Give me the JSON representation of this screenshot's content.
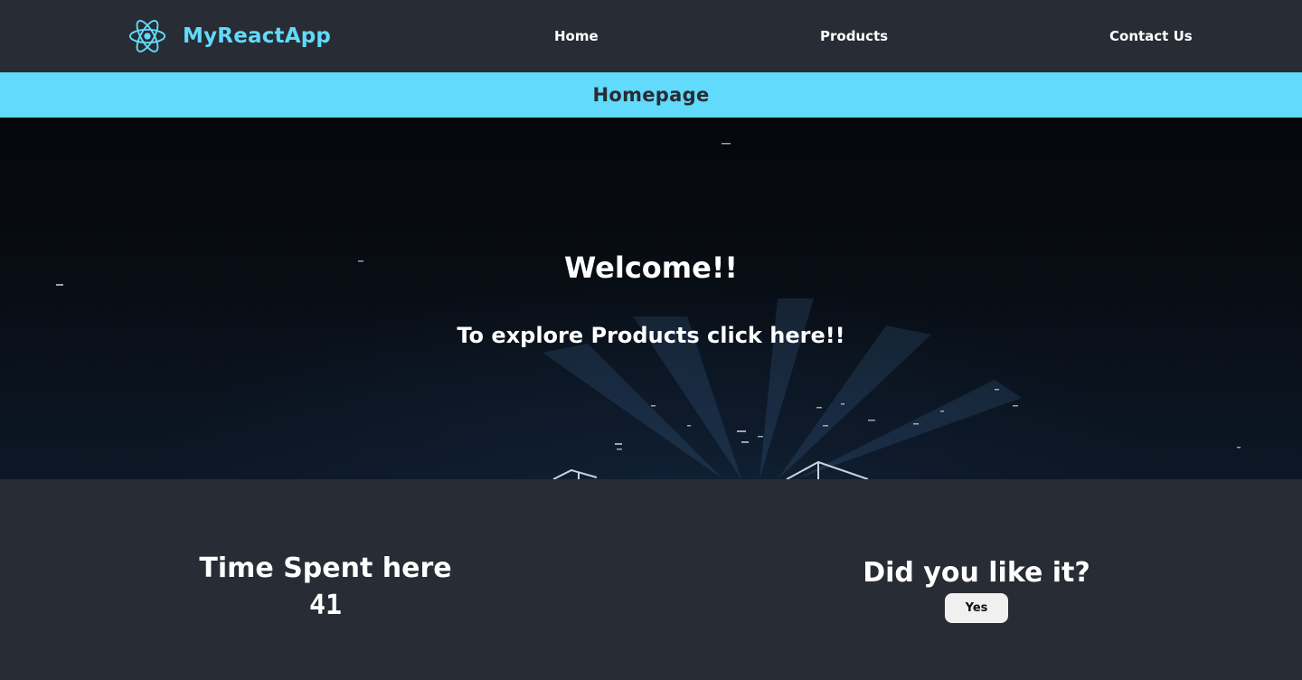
{
  "navbar": {
    "brand": {
      "icon": "react-atom-icon",
      "label": "MyReactApp"
    },
    "links": {
      "home": "Home",
      "products": "Products",
      "contact": "Contact Us"
    }
  },
  "page": {
    "title": "Homepage"
  },
  "hero": {
    "welcome": "Welcome!!",
    "explore": "To explore Products click here!!"
  },
  "stats": {
    "time_title": "Time Spent here",
    "time_value": "41"
  },
  "feedback": {
    "question": "Did you like it?",
    "yes_label": "Yes"
  },
  "colors": {
    "accent": "#61dafb",
    "background": "#282c34",
    "text": "#ffffff",
    "button_bg": "#f0f0f0"
  }
}
